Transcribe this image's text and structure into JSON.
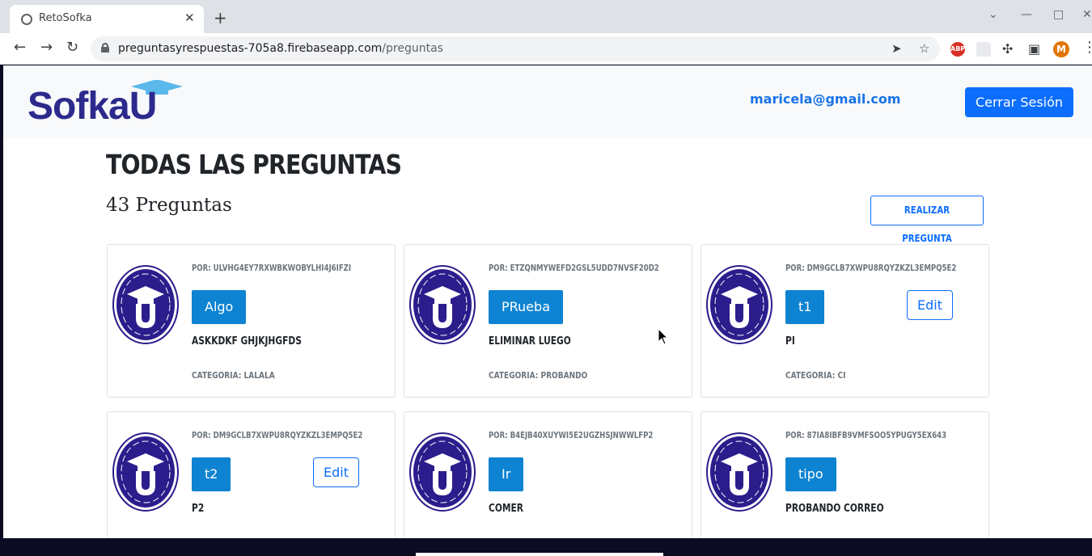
{
  "browser": {
    "tab_title": "RetoSofka",
    "url_domain": "preguntasyrespuestas-705a8.firebaseapp.com",
    "url_path": "/preguntas",
    "profile_initial": "M",
    "adblock_label": "ABP"
  },
  "header": {
    "logo_text": "SofkaU",
    "user_email": "maricela@gmail.com",
    "logout_label": "Cerrar Sesión"
  },
  "main": {
    "title": "TODAS LAS PREGUNTAS",
    "count": "43 Preguntas",
    "ask_button": "REALIZAR PREGUNTA"
  },
  "questions": [
    {
      "author": "POR: ULVHG4EY7RXWBKWOBYLHI4J6IFZI",
      "tag": "Algo",
      "question": "ASKKDKF GHJKJHGFDS",
      "category": "CATEGORIA: LALALA",
      "edit": ""
    },
    {
      "author": "POR: ETZQNMYWEFD2GSL5UDD7NVSF20D2",
      "tag": "PRueba",
      "question": "ELIMINAR LUEGO",
      "category": "CATEGORIA: PROBANDO",
      "edit": ""
    },
    {
      "author": "POR: DM9GCLB7XWPU8RQYZKZL3EMPQ5E2",
      "tag": "t1",
      "question": "PI",
      "category": "CATEGORIA: CI",
      "edit": "Edit"
    },
    {
      "author": "POR: DM9GCLB7XWPU8RQYZKZL3EMPQ5E2",
      "tag": "t2",
      "question": "P2",
      "category": "",
      "edit": "Edit"
    },
    {
      "author": "POR: B4EJB40XUYWI5E2UGZHSJNWWLFP2",
      "tag": "Ir",
      "question": "COMER",
      "category": "",
      "edit": ""
    },
    {
      "author": "POR: 87IA8IBFB9VMFSOO5YPUGY5EX643",
      "tag": "tipo",
      "question": "PROBANDO CORREO",
      "category": "",
      "edit": ""
    }
  ],
  "colors": {
    "primary": "#0d6efd",
    "tag_blue": "#0d83d1",
    "logo_navy": "#2c2a8c",
    "logo_cap": "#5bb8ea"
  }
}
